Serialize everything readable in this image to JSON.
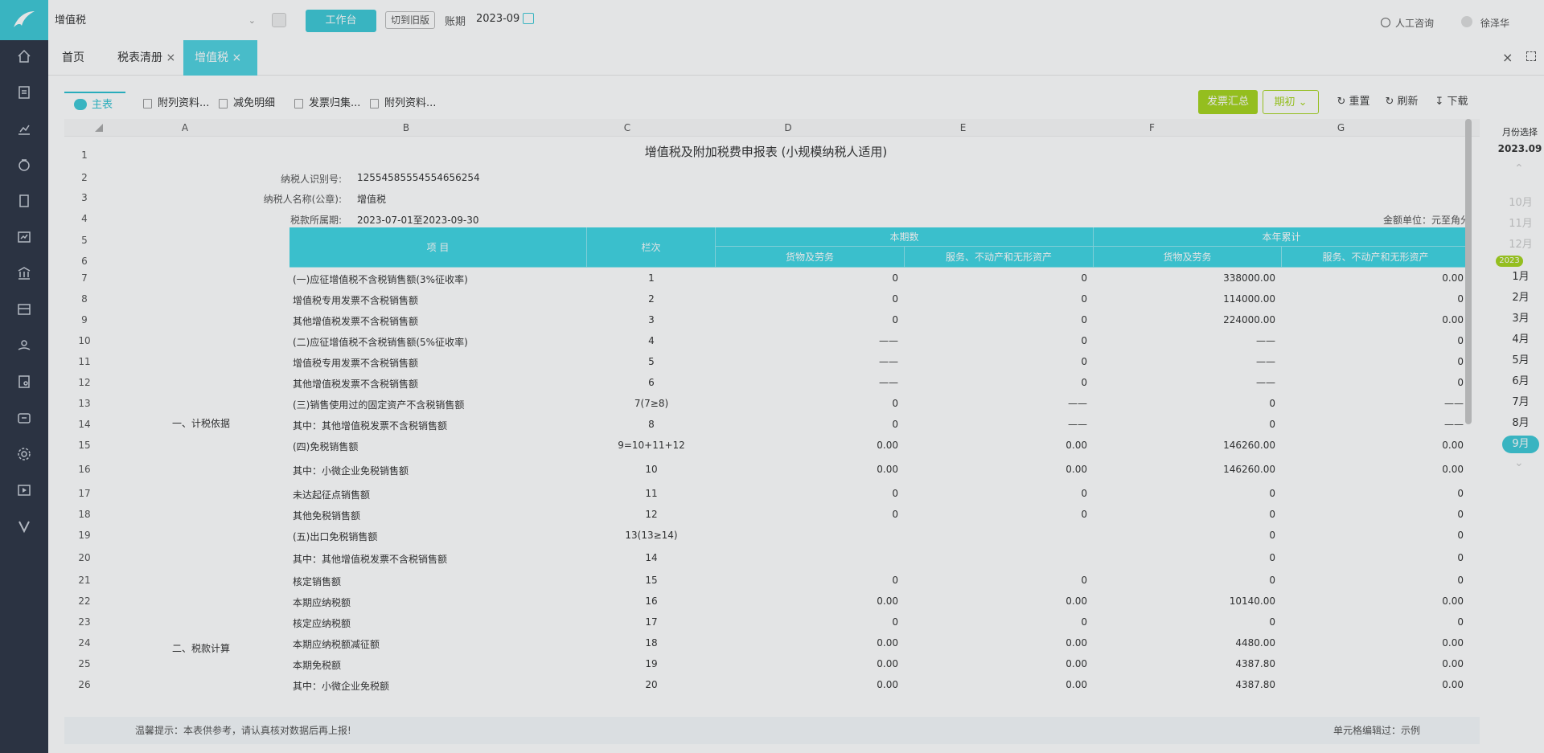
{
  "topbar": {
    "tax_type": "增值税",
    "workbench_label": "工作台",
    "old_version_label": "切到旧版",
    "period_label": "账期",
    "period_value": "2023-09",
    "consult_label": "人工咨询",
    "user_name": "徐泽华"
  },
  "page_tabs": [
    {
      "label": "首页"
    },
    {
      "label": "税表清册"
    },
    {
      "label": "增值税"
    }
  ],
  "sheet_tabs": [
    {
      "label": "主表"
    },
    {
      "label": "附列资料..."
    },
    {
      "label": "减免明细"
    },
    {
      "label": "发票归集..."
    },
    {
      "label": "附列资料..."
    }
  ],
  "actions": {
    "invoice_summary": "发票汇总",
    "initial": "期初",
    "reset": "重置",
    "refresh": "刷新",
    "download": "下载"
  },
  "columns": [
    "A",
    "B",
    "C",
    "D",
    "E",
    "F",
    "G"
  ],
  "form": {
    "title": "增值税及附加税费申报表 (小规模纳税人适用)",
    "taxpayer_id_label": "纳税人识别号:",
    "taxpayer_id": "12554585554554656254",
    "taxpayer_name_label": "纳税人名称(公章):",
    "taxpayer_name": "增值税",
    "tax_period_label": "税款所属期:",
    "tax_period": "2023-07-01至2023-09-30",
    "amount_unit": "金额单位：元至角分",
    "header_item": "项 目",
    "header_col": "栏次",
    "header_current": "本期数",
    "header_ytd": "本年累计",
    "header_goods": "货物及劳务",
    "header_services": "服务、不动产和无形资产",
    "section1": "一、计税依据",
    "section2": "二、税款计算"
  },
  "rows": [
    {
      "n": "7",
      "item": "(一)应征增值税不含税销售额(3%征收率)",
      "col": "1",
      "d": "0",
      "e": "0",
      "f": "338000.00",
      "g": "0.00"
    },
    {
      "n": "8",
      "item": "增值税专用发票不含税销售额",
      "col": "2",
      "d": "0",
      "e": "0",
      "f": "114000.00",
      "g": "0"
    },
    {
      "n": "9",
      "item": "其他增值税发票不含税销售额",
      "col": "3",
      "d": "0",
      "e": "0",
      "f": "224000.00",
      "g": "0.00"
    },
    {
      "n": "10",
      "item": "(二)应征增值税不含税销售额(5%征收率)",
      "col": "4",
      "d": "——",
      "e": "0",
      "f": "——",
      "g": "0"
    },
    {
      "n": "11",
      "item": "增值税专用发票不含税销售额",
      "col": "5",
      "d": "——",
      "e": "0",
      "f": "——",
      "g": "0"
    },
    {
      "n": "12",
      "item": "其他增值税发票不含税销售额",
      "col": "6",
      "d": "——",
      "e": "0",
      "f": "——",
      "g": "0"
    },
    {
      "n": "13",
      "item": "(三)销售使用过的固定资产不含税销售额",
      "col": "7(7≥8)",
      "d": "0",
      "e": "——",
      "f": "0",
      "g": "——"
    },
    {
      "n": "14",
      "item": "其中：其他增值税发票不含税销售额",
      "col": "8",
      "d": "0",
      "e": "——",
      "f": "0",
      "g": "——"
    },
    {
      "n": "15",
      "item": "(四)免税销售额",
      "col": "9=10+11+12",
      "d": "0.00",
      "e": "0.00",
      "f": "146260.00",
      "g": "0.00"
    },
    {
      "n": "16",
      "item": "其中：小微企业免税销售额",
      "col": "10",
      "d": "0.00",
      "e": "0.00",
      "f": "146260.00",
      "g": "0.00"
    },
    {
      "n": "17",
      "item": "未达起征点销售额",
      "col": "11",
      "d": "0",
      "e": "0",
      "f": "0",
      "g": "0"
    },
    {
      "n": "18",
      "item": "其他免税销售额",
      "col": "12",
      "d": "0",
      "e": "0",
      "f": "0",
      "g": "0"
    },
    {
      "n": "19",
      "item": "(五)出口免税销售额",
      "col": "13(13≥14)",
      "d": "",
      "e": "",
      "f": "0",
      "g": "0"
    },
    {
      "n": "20",
      "item": "其中：其他增值税发票不含税销售额",
      "col": "14",
      "d": "",
      "e": "",
      "f": "0",
      "g": "0"
    },
    {
      "n": "21",
      "item": "核定销售额",
      "col": "15",
      "d": "0",
      "e": "0",
      "f": "0",
      "g": "0"
    },
    {
      "n": "22",
      "item": "本期应纳税额",
      "col": "16",
      "d": "0.00",
      "e": "0.00",
      "f": "10140.00",
      "g": "0.00"
    },
    {
      "n": "23",
      "item": "核定应纳税额",
      "col": "17",
      "d": "0",
      "e": "0",
      "f": "0",
      "g": "0"
    },
    {
      "n": "24",
      "item": "本期应纳税额减征额",
      "col": "18",
      "d": "0.00",
      "e": "0.00",
      "f": "4480.00",
      "g": "0.00"
    },
    {
      "n": "25",
      "item": "本期免税额",
      "col": "19",
      "d": "0.00",
      "e": "0.00",
      "f": "4387.80",
      "g": "0.00"
    },
    {
      "n": "26",
      "item": "其中：小微企业免税额",
      "col": "20",
      "d": "0.00",
      "e": "0.00",
      "f": "4387.80",
      "g": "0.00"
    }
  ],
  "footer": {
    "tip": "温馨提示：本表供参考，请认真核对数据后再上报!",
    "legend": "单元格编辑过：示例"
  },
  "month_panel": {
    "title": "月份选择",
    "selected": "2023.09",
    "prev_months": [
      "10月",
      "11月",
      "12月"
    ],
    "year_badge": "2023",
    "months": [
      "1月",
      "2月",
      "3月",
      "4月",
      "5月",
      "6月",
      "7月",
      "8月",
      "9月"
    ]
  },
  "colors": {
    "accent": "#3ec9d6",
    "sidebar": "#2e3646",
    "header_fill": "#3fd5e3",
    "green_button": "#a6d41e"
  }
}
